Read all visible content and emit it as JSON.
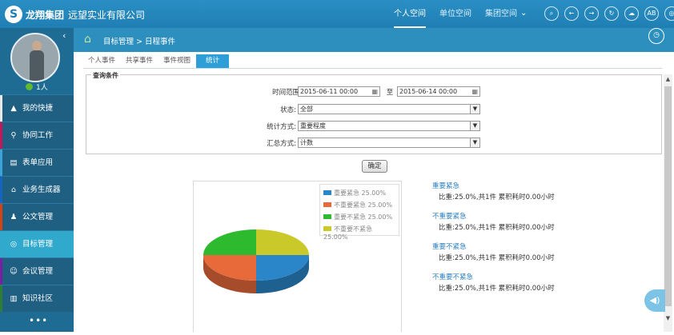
{
  "app": {
    "brand": "龙翔集团",
    "company": "远望实业有限公司",
    "logo_glyph": "S"
  },
  "topnav": [
    {
      "label": "个人空间",
      "active": true
    },
    {
      "label": "单位空间",
      "active": false
    },
    {
      "label": "集团空间",
      "active": false
    }
  ],
  "toolbar_icons": [
    "search-icon",
    "back-icon",
    "forward-icon",
    "refresh-icon",
    "cloud-icon",
    "ab-icon",
    "settings-icon"
  ],
  "toolbar_ab": "AB",
  "sidebar": {
    "online_count": "1人",
    "items": [
      {
        "label": "我的快捷",
        "icon": "▲",
        "color": "#e8e8e8"
      },
      {
        "label": "协同工作",
        "icon": "⚲",
        "color": "#c2185b"
      },
      {
        "label": "表单应用",
        "icon": "▤",
        "color": "#3aa4d8"
      },
      {
        "label": "业务生成器",
        "icon": "⌂",
        "color": "#1565c0"
      },
      {
        "label": "公文管理",
        "icon": "♟",
        "color": "#d84315"
      },
      {
        "label": "目标管理",
        "icon": "◎",
        "color": "#31a9cd"
      },
      {
        "label": "会议管理",
        "icon": "☺",
        "color": "#7b1fa2"
      },
      {
        "label": "知识社区",
        "icon": "▥",
        "color": "#2e7d32"
      }
    ],
    "more": "•••"
  },
  "breadcrumb": "目标管理 > 日程事件",
  "tabs": [
    {
      "label": "个人事件",
      "active": false
    },
    {
      "label": "共享事件",
      "active": false
    },
    {
      "label": "事件视图",
      "active": false
    },
    {
      "label": "统计",
      "active": true
    }
  ],
  "query": {
    "legend": "查询条件",
    "time_label": "时间范围:",
    "start": "2015-06-11 00:00",
    "to": "至",
    "end": "2015-06-14 00:00",
    "status_label": "状态:",
    "status_value": "全部",
    "method_label": "统计方式:",
    "method_value": "重要程度",
    "summary_label": "汇总方式:",
    "summary_value": "计数",
    "confirm": "确定"
  },
  "colors": {
    "blue": "#2a86c8",
    "orange": "#e8693a",
    "green": "#2eba2e",
    "yellow": "#c9c92a"
  },
  "chart_data": {
    "type": "pie",
    "series": [
      {
        "name": "重要紧急",
        "value": 25.0,
        "color": "#2a86c8"
      },
      {
        "name": "不重要紧急",
        "value": 25.0,
        "color": "#e8693a"
      },
      {
        "name": "重要不紧急",
        "value": 25.0,
        "color": "#2eba2e"
      },
      {
        "name": "不重要不紧急",
        "value": 25.0,
        "color": "#c9c92a"
      }
    ],
    "legend_labels": [
      "重要紧急 25.00%",
      "不重要紧急 25.00%",
      "重要不紧急 25.00%",
      "不重要不紧急 25.00%"
    ],
    "legend_position": "top-right"
  },
  "stats": [
    {
      "name": "重要紧急",
      "line": "比重:25.0%,共1件 累积耗时0.00小时"
    },
    {
      "name": "不重要紧急",
      "line": "比重:25.0%,共1件 累积耗时0.00小时"
    },
    {
      "name": "重要不紧急",
      "line": "比重:25.0%,共1件 累积耗时0.00小时"
    },
    {
      "name": "不重要不紧急",
      "line": "比重:25.0%,共1件 累积耗时0.00小时"
    }
  ]
}
